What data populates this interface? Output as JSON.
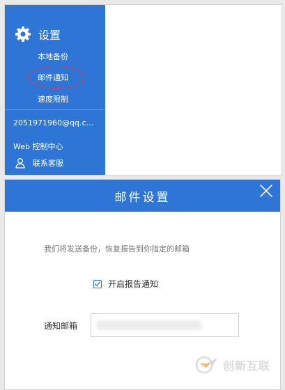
{
  "sidebar": {
    "title": "设置",
    "items": [
      {
        "label": "本地备份"
      },
      {
        "label": "邮件通知"
      },
      {
        "label": "速度限制"
      }
    ],
    "account": "2051971960@qq.c...",
    "web_console": "Web 控制中心",
    "contact": "联系客服"
  },
  "dialog": {
    "title": "邮件设置",
    "description": "我们将发送备份，恢复报告到你指定的邮箱",
    "report_toggle_label": "开启报告通知",
    "report_toggle_checked": true,
    "email_label": "通知邮箱",
    "email_value": ""
  },
  "watermark": {
    "text": "创新互联"
  },
  "icons": {
    "settings": "gear-icon",
    "contact": "user-icon",
    "close": "close-icon",
    "check": "checkmark-icon"
  },
  "colors": {
    "accent": "#2f75d6",
    "annotation": "#d23b6a"
  }
}
